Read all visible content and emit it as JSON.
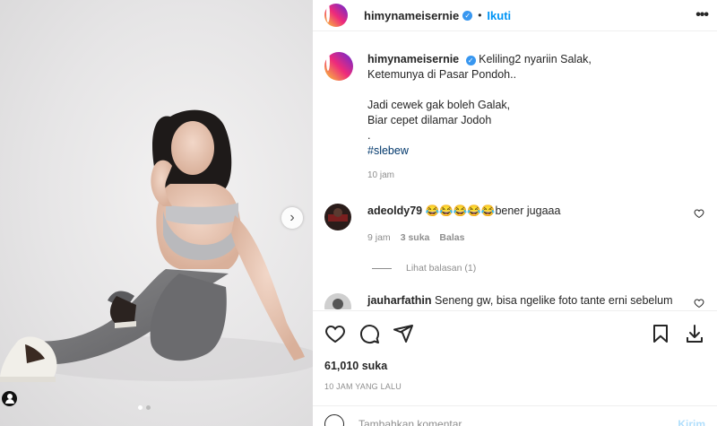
{
  "post": {
    "username": "himynameisernie",
    "follow_label": "Ikuti",
    "dot": "•",
    "more_label": "•••"
  },
  "caption": {
    "username": "himynameisernie",
    "lines": [
      "Keliling2 nyariin Salak,",
      "Ketemunya di Pasar Pondoh..",
      "",
      "Jadi cewek gak boleh Galak,",
      "Biar cepet dilamar Jodoh",
      "."
    ],
    "hashtag": "#slebew",
    "time": "10 jam"
  },
  "comments": [
    {
      "username": "adeoldy79",
      "text": "😂😂😂😂😂bener jugaaa",
      "time": "9 jam",
      "likes": "3 suka",
      "reply_label": "Balas",
      "view_replies": "Lihat balasan (1)"
    },
    {
      "username": "jauharfathin",
      "text": "Seneng gw, bisa ngelike foto tante erni sebelum"
    }
  ],
  "actions": {
    "icons": [
      "heart-icon",
      "comment-icon",
      "share-icon",
      "bookmark-icon",
      "download-icon"
    ]
  },
  "likes_text": "61,010 suka",
  "posted_ago": "10 JAM YANG LALU",
  "add_comment": {
    "placeholder": "Tambahkan komentar...",
    "post_label": "Kirim"
  },
  "colors": {
    "accent": "#0095f6",
    "verified": "#3897f0",
    "muted": "#8e8e8e"
  }
}
